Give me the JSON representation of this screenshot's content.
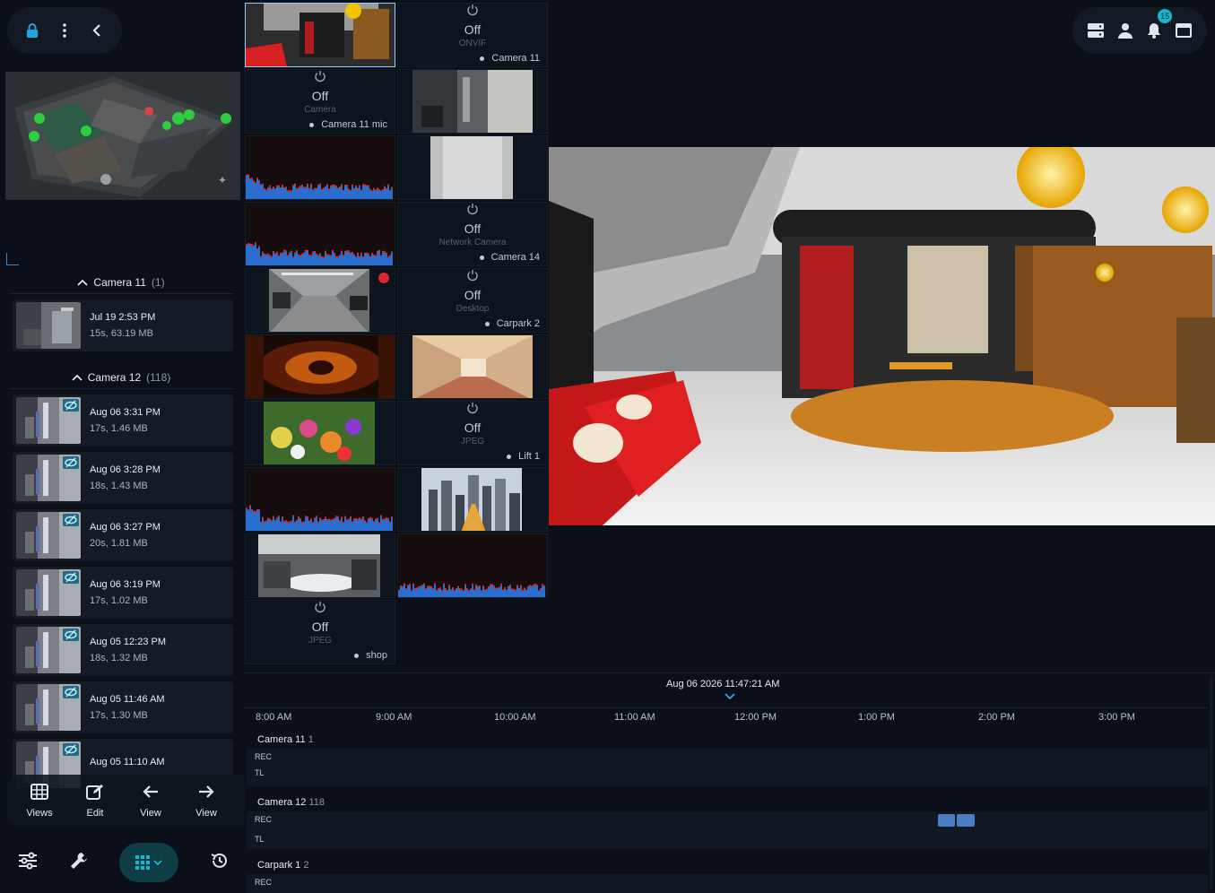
{
  "app": {
    "colors": {
      "accent": "#13b7c9",
      "recording": "#e0252c",
      "timeline_segment": "#4a7ec2",
      "selected_border": "#8fd0ff"
    }
  },
  "toolbar_left": {
    "icons": [
      "lock-icon",
      "more-vertical-icon",
      "chevron-left-icon"
    ]
  },
  "toolbar_right": {
    "icons": [
      "server-icon",
      "user-icon",
      "bell-icon",
      "window-icon"
    ],
    "notification_count": "15"
  },
  "camera_cells": [
    {
      "kind": "video",
      "name": "",
      "selected": true
    },
    {
      "kind": "off",
      "status": "Off",
      "type": "ONVIF",
      "name": "Camera 11"
    },
    {
      "kind": "off",
      "status": "Off",
      "type": "Camera",
      "name": "Camera 11 mic"
    },
    {
      "kind": "video",
      "name": ""
    },
    {
      "kind": "audio",
      "name": ""
    },
    {
      "kind": "video",
      "name": ""
    },
    {
      "kind": "audio",
      "name": ""
    },
    {
      "kind": "off",
      "status": "Off",
      "type": "Network Camera",
      "name": "Camera 14"
    },
    {
      "kind": "video",
      "name": "",
      "recording": true
    },
    {
      "kind": "off",
      "status": "Off",
      "type": "Desktop",
      "name": "Carpark 2"
    },
    {
      "kind": "video",
      "name": ""
    },
    {
      "kind": "video",
      "name": ""
    },
    {
      "kind": "video",
      "name": ""
    },
    {
      "kind": "off",
      "status": "Off",
      "type": "JPEG",
      "name": "Lift 1"
    },
    {
      "kind": "audio",
      "name": ""
    },
    {
      "kind": "video",
      "name": ""
    },
    {
      "kind": "video",
      "name": ""
    },
    {
      "kind": "audio",
      "name": ""
    },
    {
      "kind": "off",
      "status": "Off",
      "type": "JPEG",
      "name": "shop"
    }
  ],
  "recordings": {
    "groups": [
      {
        "title": "Camera 11",
        "count": "(1)",
        "items": [
          {
            "date": "Jul 19 2:53 PM",
            "info": "15s, 63.19 MB",
            "thumb": "room"
          }
        ]
      },
      {
        "title": "Camera 12",
        "count": "(118)",
        "items": [
          {
            "date": "Aug 06 3:31 PM",
            "info": "17s, 1.46 MB",
            "thumb": "office"
          },
          {
            "date": "Aug 06 3:28 PM",
            "info": "18s, 1.43 MB",
            "thumb": "office"
          },
          {
            "date": "Aug 06 3:27 PM",
            "info": "20s, 1.81 MB",
            "thumb": "office"
          },
          {
            "date": "Aug 06 3:19 PM",
            "info": "17s, 1.02 MB",
            "thumb": "office"
          },
          {
            "date": "Aug 05 12:23 PM",
            "info": "18s, 1.32 MB",
            "thumb": "office"
          },
          {
            "date": "Aug 05 11:46 AM",
            "info": "17s, 1.30 MB",
            "thumb": "office"
          },
          {
            "date": "Aug 05 11:10 AM",
            "info": "",
            "thumb": "office"
          }
        ]
      }
    ]
  },
  "float_tools": [
    {
      "label": "Views",
      "icon": "grid-icon"
    },
    {
      "label": "Edit",
      "icon": "edit-icon"
    },
    {
      "label": "View",
      "icon": "arrow-left-icon"
    },
    {
      "label": "View",
      "icon": "arrow-right-icon"
    }
  ],
  "bottom_tools": {
    "icons": [
      "sliders-icon",
      "wrench-icon",
      "apps-grid-icon",
      "history-icon"
    ]
  },
  "timeline": {
    "cursor_time": "Aug 06 2026 11:47:21 AM",
    "ticks": [
      "8:00 AM",
      "9:00 AM",
      "10:00 AM",
      "11:00 AM",
      "12:00 PM",
      "1:00 PM",
      "2:00 PM",
      "3:00 PM"
    ],
    "rows": [
      {
        "name": "Camera 11",
        "count": "1",
        "tracks": [
          "REC",
          "TL"
        ]
      },
      {
        "name": "Camera 12",
        "count": "118",
        "tracks": [
          "REC",
          "TL"
        ]
      },
      {
        "name": "Carpark 1",
        "count": "2",
        "tracks": [
          "REC"
        ]
      }
    ]
  }
}
